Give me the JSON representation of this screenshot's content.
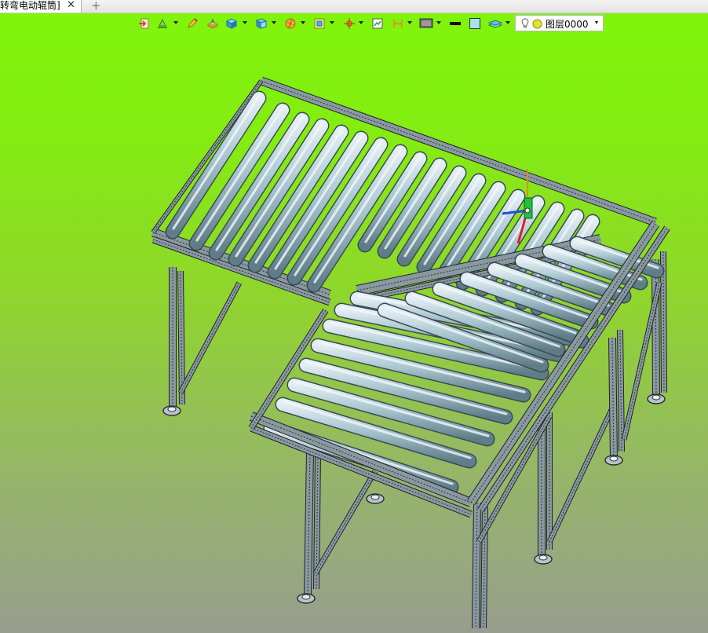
{
  "tabs": [
    {
      "label": "转弯电动辊筒]",
      "close_glyph": "✕"
    }
  ],
  "new_tab_glyph": "+",
  "toolbar": {
    "buttons": [
      {
        "icon": "exit-sketch-icon",
        "color": "#d05030"
      },
      {
        "icon": "sketch-tools-icon",
        "color": "#3a9a30"
      },
      {
        "icon": "pencil-icon",
        "color": "#d03030"
      },
      {
        "icon": "extrude-icon",
        "color": "#e0b020"
      },
      {
        "icon": "solid-box-icon",
        "color": "#2a8fd0"
      },
      {
        "icon": "view-cube-icon",
        "color": "#2a8fd0"
      },
      {
        "icon": "render-sphere-icon",
        "color": "#e08020"
      },
      {
        "icon": "frame-view-icon",
        "color": "#c0a030"
      },
      {
        "icon": "orient-axis-icon",
        "color": "#d04020"
      },
      {
        "icon": "section-view-icon",
        "color": "#30a040"
      },
      {
        "icon": "measure-icon",
        "color": "#d0a020"
      },
      {
        "icon": "display-mode-icon",
        "color": "#555555"
      },
      {
        "icon": "line-style-icon",
        "color": "#111111"
      },
      {
        "icon": "background-color-icon",
        "color": "#a8dff0"
      },
      {
        "icon": "layers-icon",
        "color": "#3aa0d0"
      }
    ],
    "layer": {
      "value": "图层0000",
      "dropdown_glyph": "▾"
    }
  }
}
